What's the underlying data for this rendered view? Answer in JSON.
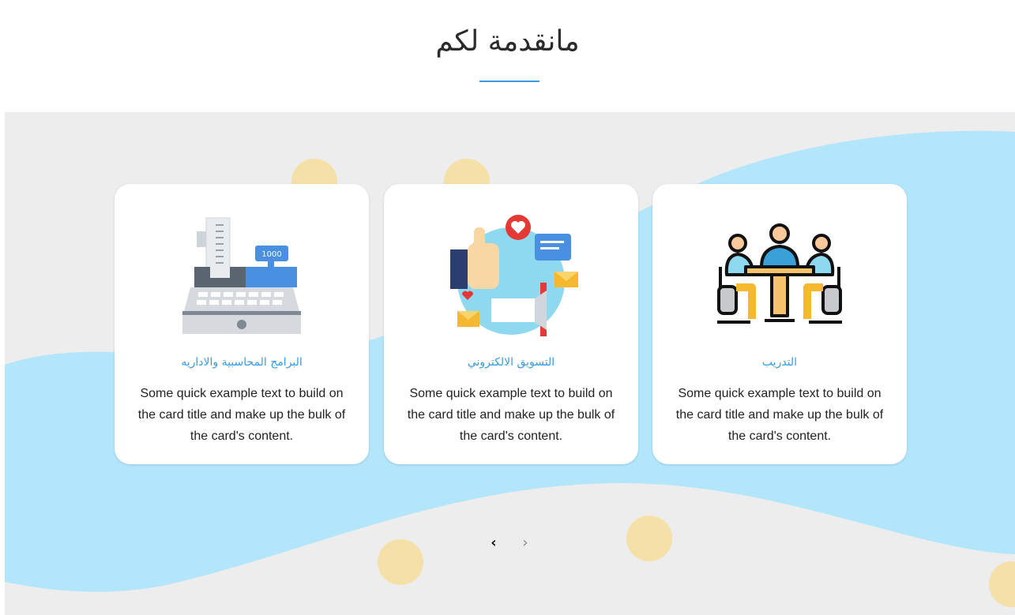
{
  "section": {
    "title": "مانقدمة لكم"
  },
  "cards": [
    {
      "title": "البرامج المحاسبية والاداريه",
      "text": "Some quick example text to build on the card title and make up the bulk of the card's content.",
      "icon": "cash-register-icon"
    },
    {
      "title": "التسويق الالكتروني",
      "text": "Some quick example text to build on the card title and make up the bulk of the card's content.",
      "icon": "digital-marketing-icon"
    },
    {
      "title": "التدريب",
      "text": "Some quick example text to build on the card title and make up the bulk of the card's content.",
      "icon": "training-meeting-icon"
    }
  ],
  "carousel": {
    "prev_label": "‹",
    "next_label": "›"
  },
  "colors": {
    "accent": "#3a9be0",
    "wave": "#b3e6fb",
    "dot": "#f5e0a8",
    "band": "#ededed"
  }
}
